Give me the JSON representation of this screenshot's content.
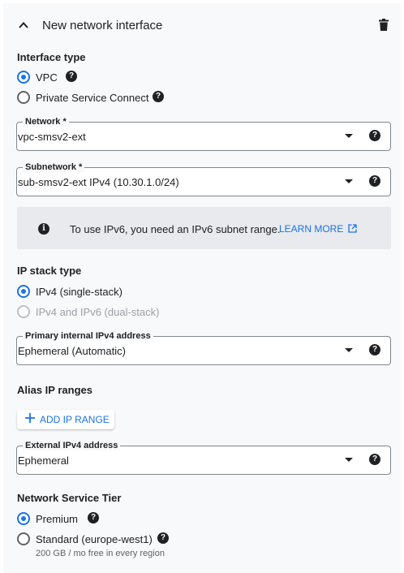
{
  "header": {
    "title": "New network interface"
  },
  "interface_type": {
    "title": "Interface type",
    "options": [
      {
        "label": "VPC",
        "selected": true
      },
      {
        "label": "Private Service Connect",
        "selected": false
      }
    ]
  },
  "network": {
    "legend": "Network *",
    "value": "vpc-smsv2-ext"
  },
  "subnetwork": {
    "legend": "Subnetwork *",
    "value": "sub-smsv2-ext IPv4 (10.30.1.0/24)"
  },
  "info": {
    "text": "To use IPv6, you need an IPv6 subnet range.",
    "link": "LEARN MORE"
  },
  "ip_stack": {
    "title": "IP stack type",
    "options": [
      {
        "label": "IPv4 (single-stack)",
        "selected": true,
        "disabled": false
      },
      {
        "label": "IPv4 and IPv6 (dual-stack)",
        "selected": false,
        "disabled": true
      }
    ]
  },
  "primary_ipv4": {
    "legend": "Primary internal IPv4 address",
    "value": "Ephemeral (Automatic)"
  },
  "alias": {
    "title": "Alias IP ranges",
    "button": "ADD IP RANGE"
  },
  "external_ipv4": {
    "legend": "External IPv4 address",
    "value": "Ephemeral"
  },
  "tier": {
    "title": "Network Service Tier",
    "options": [
      {
        "label": "Premium",
        "selected": true
      },
      {
        "label": "Standard (europe-west1)",
        "selected": false,
        "sub": "200 GB / mo free in every region"
      }
    ]
  },
  "colors": {
    "accent": "#1a73e8",
    "panel": "#f8f9fa",
    "info_bg": "#e8eaed"
  }
}
